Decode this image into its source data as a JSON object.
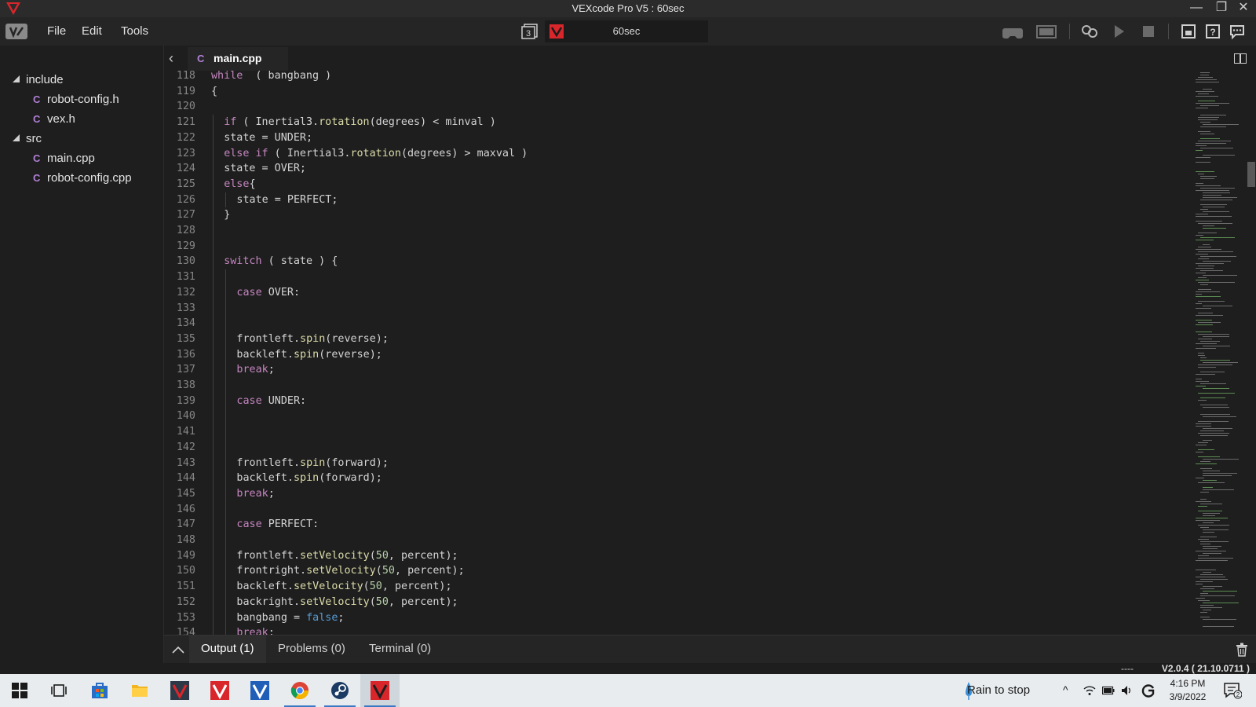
{
  "window": {
    "title": "VEXcode Pro V5 : 60sec",
    "minimize": "—",
    "restore": "❐",
    "close": "✕"
  },
  "menu": {
    "items": [
      "File",
      "Edit",
      "Tools"
    ]
  },
  "project": {
    "slot": "3",
    "name": "60sec"
  },
  "explorer": {
    "items": [
      {
        "type": "folder",
        "label": "include"
      },
      {
        "type": "file",
        "label": "robot-config.h"
      },
      {
        "type": "file",
        "label": "vex.h"
      },
      {
        "type": "folder",
        "label": "src"
      },
      {
        "type": "file",
        "label": "main.cpp"
      },
      {
        "type": "file",
        "label": "robot-config.cpp"
      }
    ]
  },
  "tab": {
    "label": "main.cpp",
    "icon": "cpp-file-icon"
  },
  "editor": {
    "lines": [
      {
        "n": "118",
        "indent": 0,
        "code": "while  ( bangbang )"
      },
      {
        "n": "119",
        "indent": 0,
        "code": "{"
      },
      {
        "n": "120",
        "indent": 0,
        "code": ""
      },
      {
        "n": "121",
        "indent": 1,
        "code": "if ( Inertial3.rotation(degrees) < minval )"
      },
      {
        "n": "122",
        "indent": 1,
        "code": "state = UNDER;"
      },
      {
        "n": "123",
        "indent": 1,
        "code": "else if ( Inertial3.rotation(degrees) > maxval )"
      },
      {
        "n": "124",
        "indent": 1,
        "code": "state = OVER;"
      },
      {
        "n": "125",
        "indent": 1,
        "code": "else{"
      },
      {
        "n": "126",
        "indent": 2,
        "code": "state = PERFECT;"
      },
      {
        "n": "127",
        "indent": 1,
        "code": "}"
      },
      {
        "n": "128",
        "indent": 0,
        "code": ""
      },
      {
        "n": "129",
        "indent": 0,
        "code": ""
      },
      {
        "n": "130",
        "indent": 1,
        "code": "switch ( state ) {"
      },
      {
        "n": "131",
        "indent": 0,
        "code": ""
      },
      {
        "n": "132",
        "indent": 2,
        "code": "case OVER:"
      },
      {
        "n": "133",
        "indent": 0,
        "code": ""
      },
      {
        "n": "134",
        "indent": 0,
        "code": ""
      },
      {
        "n": "135",
        "indent": 2,
        "code": "frontleft.spin(reverse);"
      },
      {
        "n": "136",
        "indent": 2,
        "code": "backleft.spin(reverse);"
      },
      {
        "n": "137",
        "indent": 2,
        "code": "break;"
      },
      {
        "n": "138",
        "indent": 0,
        "code": ""
      },
      {
        "n": "139",
        "indent": 2,
        "code": "case UNDER:"
      },
      {
        "n": "140",
        "indent": 0,
        "code": ""
      },
      {
        "n": "141",
        "indent": 0,
        "code": ""
      },
      {
        "n": "142",
        "indent": 0,
        "code": ""
      },
      {
        "n": "143",
        "indent": 2,
        "code": "frontleft.spin(forward);"
      },
      {
        "n": "144",
        "indent": 2,
        "code": "backleft.spin(forward);"
      },
      {
        "n": "145",
        "indent": 2,
        "code": "break;"
      },
      {
        "n": "146",
        "indent": 0,
        "code": ""
      },
      {
        "n": "147",
        "indent": 2,
        "code": "case PERFECT:"
      },
      {
        "n": "148",
        "indent": 0,
        "code": ""
      },
      {
        "n": "149",
        "indent": 2,
        "code": "frontleft.setVelocity(50, percent);"
      },
      {
        "n": "150",
        "indent": 2,
        "code": "frontright.setVelocity(50, percent);"
      },
      {
        "n": "151",
        "indent": 2,
        "code": "backleft.setVelocity(50, percent);"
      },
      {
        "n": "152",
        "indent": 2,
        "code": "backright.setVelocity(50, percent);"
      },
      {
        "n": "153",
        "indent": 2,
        "code": "bangbang = false;"
      },
      {
        "n": "154",
        "indent": 2,
        "code": "break;"
      }
    ]
  },
  "panel": {
    "tabs": [
      "Output (1)",
      "Problems (0)",
      "Terminal (0)"
    ]
  },
  "status": {
    "indicator": "----",
    "version": "V2.0.4 ( 21.10.0711 )"
  },
  "taskbar": {
    "weather": "Rain to stop",
    "time": "4:16 PM",
    "date": "3/9/2022",
    "notification_count": "2"
  },
  "colors": {
    "keyword": "#c586c0",
    "function": "#dcdcaa",
    "number": "#b5cea8",
    "boolean": "#569cd6",
    "vex_red": "#d9262b"
  }
}
